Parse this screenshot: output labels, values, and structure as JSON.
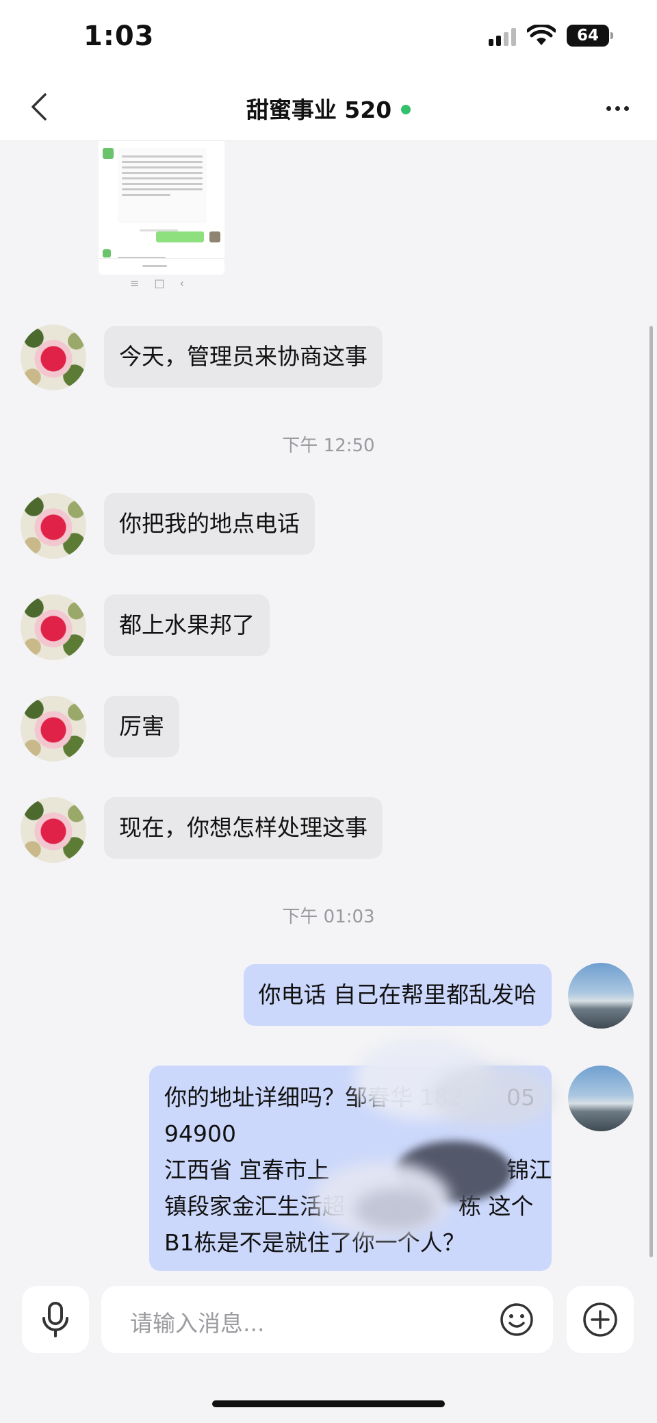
{
  "status_bar": {
    "time": "1:03",
    "battery": "64"
  },
  "header": {
    "title": "甜蜜事业 520",
    "online_color": "#33c06a"
  },
  "messages": {
    "m1": "今天，管理员来协商这事",
    "ts1": "下午 12:50",
    "m2": "你把我的地点电话",
    "m3": "都上水果邦了",
    "m4": "厉害",
    "m5": "现在，你想怎样处理这事",
    "ts2": "下午 01:03",
    "m6": "你电话 自己在帮里都乱发哈",
    "m7_line1": "你的地址详细吗？邹春华 182",
    "m7_line2": "94900",
    "m7_line3": "江西省  宜春市上",
    "m7_line4": "镇段家金汇生活超",
    "m7_line5": "B1栋是不是就住了你一个人？",
    "m7_partial_a": "05",
    "m7_partial_b": "锦江",
    "m7_partial_c": "栋  这个"
  },
  "input": {
    "placeholder": "请输入消息..."
  },
  "colors": {
    "incoming_bubble": "#e8e8ea",
    "outgoing_bubble": "#ccd8fb",
    "background": "#f4f4f6"
  }
}
